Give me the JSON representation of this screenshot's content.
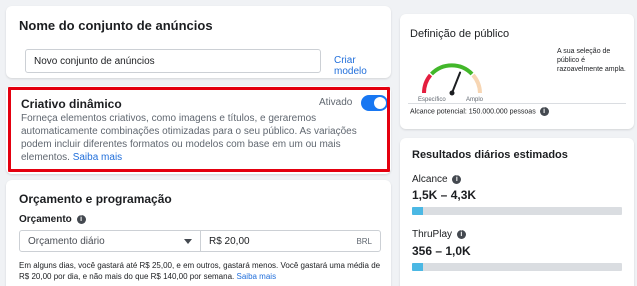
{
  "adset": {
    "title": "Nome do conjunto de anúncios",
    "name_value": "Novo conjunto de anúncios",
    "create_model_link": "Criar modelo"
  },
  "creative": {
    "title": "Criativo dinâmico",
    "toggle_label": "Ativado",
    "toggle_on": true,
    "description": "Forneça elementos criativos, como imagens e títulos, e geraremos automaticamente combinações otimizadas para o seu público. As variações podem incluir diferentes formatos ou modelos com base em um ou mais elementos.",
    "learn_more": "Saiba mais"
  },
  "budget": {
    "title": "Orçamento e programação",
    "label": "Orçamento",
    "select_value": "Orçamento diário",
    "amount_value": "R$ 20,00",
    "currency": "BRL",
    "note": "Em alguns dias, você gastará até R$ 25,00, e em outros, gastará menos. Você gastará uma média de R$ 20,00 por dia, e não mais do que R$ 140,00 por semana.",
    "note_link": "Saiba mais"
  },
  "audience": {
    "title": "Definição de público",
    "gauge_left_label": "Específico",
    "gauge_right_label": "Amplo",
    "gauge_level": 0.62,
    "description": "A sua seleção de público é razoavelmente ampla.",
    "potential_reach": "Alcance potencial: 150.000.000 pessoas"
  },
  "results": {
    "title": "Resultados diários estimados",
    "metrics": [
      {
        "label": "Alcance",
        "value": "1,5K – 4,3K",
        "fill": 0.05
      },
      {
        "label": "ThruPlay",
        "value": "356 – 1,0K",
        "fill": 0.05
      }
    ]
  },
  "colors": {
    "accent": "#1877f2",
    "highlight": "#e4000f",
    "bar_fill": "#4bb8e4",
    "link": "#216fdb"
  },
  "icons": {
    "info": "info-icon",
    "caret": "chevron-down-icon"
  }
}
